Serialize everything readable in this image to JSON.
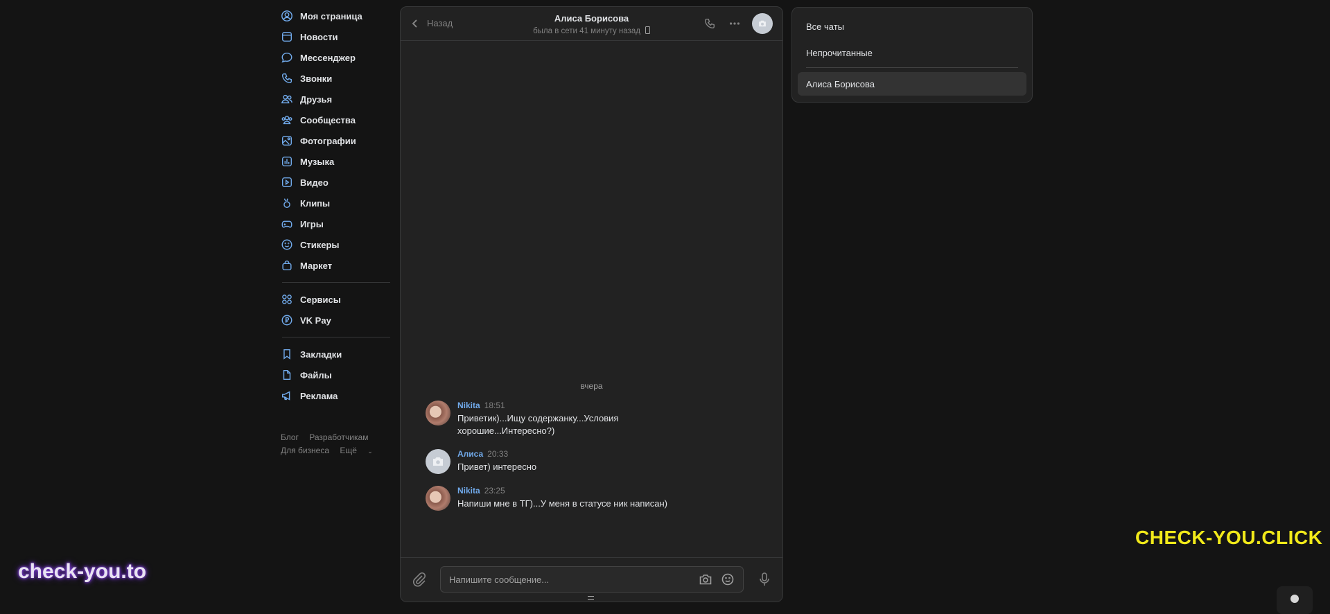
{
  "nav": {
    "items": [
      {
        "label": "Моя страница",
        "icon": "user-circle-icon"
      },
      {
        "label": "Новости",
        "icon": "news-icon"
      },
      {
        "label": "Мессенджер",
        "icon": "message-icon"
      },
      {
        "label": "Звонки",
        "icon": "phone-icon"
      },
      {
        "label": "Друзья",
        "icon": "friends-icon"
      },
      {
        "label": "Сообщества",
        "icon": "communities-icon"
      },
      {
        "label": "Фотографии",
        "icon": "photo-icon"
      },
      {
        "label": "Музыка",
        "icon": "music-icon"
      },
      {
        "label": "Видео",
        "icon": "video-icon"
      },
      {
        "label": "Клипы",
        "icon": "clips-icon"
      },
      {
        "label": "Игры",
        "icon": "gamepad-icon"
      },
      {
        "label": "Стикеры",
        "icon": "smile-icon"
      },
      {
        "label": "Маркет",
        "icon": "bag-icon"
      }
    ],
    "items2": [
      {
        "label": "Сервисы",
        "icon": "services-icon"
      },
      {
        "label": "VK Pay",
        "icon": "vkpay-icon"
      }
    ],
    "items3": [
      {
        "label": "Закладки",
        "icon": "bookmark-icon"
      },
      {
        "label": "Файлы",
        "icon": "file-icon"
      },
      {
        "label": "Реклама",
        "icon": "megaphone-icon"
      }
    ],
    "footer": {
      "blog": "Блог",
      "developers": "Разработчикам",
      "business": "Для бизнеса",
      "more": "Ещё"
    }
  },
  "chat": {
    "back_label": "Назад",
    "contact_name": "Алиса Борисова",
    "status": "была в сети 41 минуту назад",
    "date_separator": "вчера",
    "messages": [
      {
        "author": "Nikita",
        "time": "18:51",
        "text": "Приветик)...Ищу содержанку...Условия хорошие...Интересно?)"
      },
      {
        "author": "Алиса",
        "time": "20:33",
        "text": "Привет) интересно"
      },
      {
        "author": "Nikita",
        "time": "23:25",
        "text": "Напиши мне в ТГ)...У меня в статусе ник написан)"
      }
    ],
    "composer_placeholder": "Напишите сообщение..."
  },
  "filters": {
    "all": "Все чаты",
    "unread": "Непрочитанные",
    "contact": "Алиса Борисова"
  },
  "watermarks": {
    "top": "CHECK-YOU.CLICK",
    "bottom": "check-you.to"
  },
  "colors": {
    "accent": "#71aaeb",
    "background": "#141414",
    "panel": "#222222",
    "watermark_yellow": "#f2ea1a"
  }
}
